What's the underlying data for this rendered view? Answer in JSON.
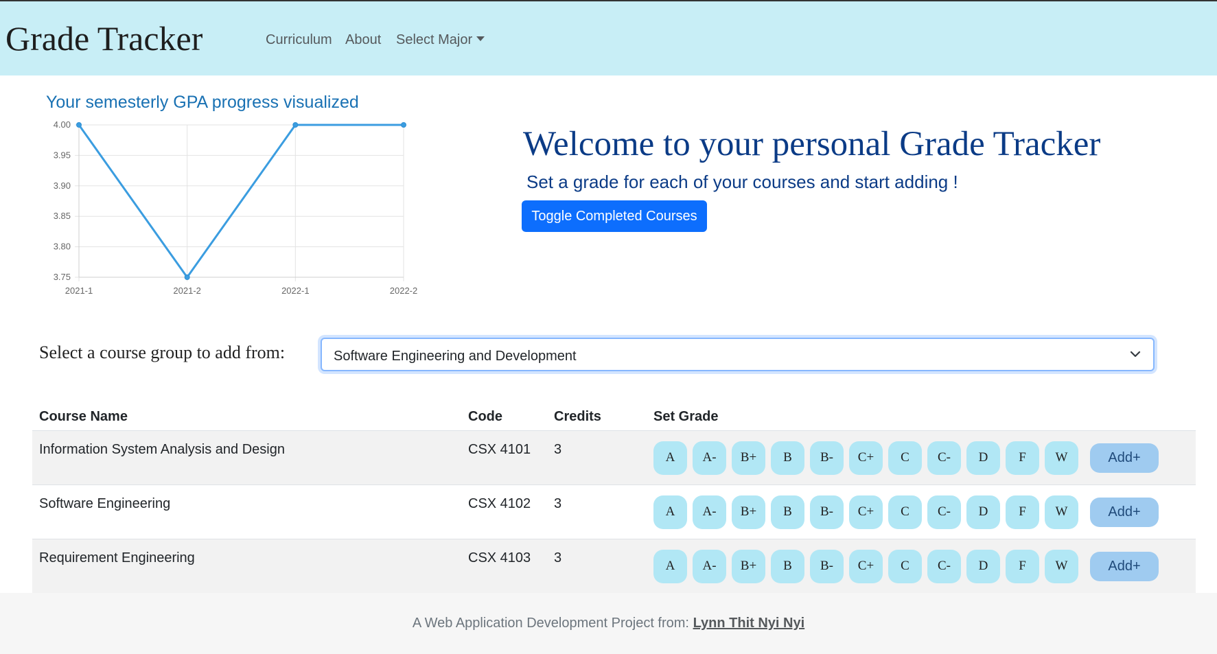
{
  "navbar": {
    "brand": "Grade Tracker",
    "links": [
      "Curriculum",
      "About",
      "Select Major"
    ]
  },
  "chart": {
    "title": "Your semesterly GPA progress visualized"
  },
  "chart_data": {
    "type": "line",
    "categories": [
      "2021-1",
      "2021-2",
      "2022-1",
      "2022-2"
    ],
    "values": [
      4.0,
      3.75,
      4.0,
      4.0
    ],
    "ylim": [
      3.75,
      4.0
    ],
    "yticks": [
      "4.00",
      "3.95",
      "3.90",
      "3.85",
      "3.80",
      "3.75"
    ],
    "line_color": "#3b9de0",
    "grid": true,
    "title": "",
    "xlabel": "",
    "ylabel": ""
  },
  "hero": {
    "heading": "Welcome to your personal Grade Tracker",
    "subtitle": "Set a grade for each of your courses and start adding !",
    "toggle_label": "Toggle Completed Courses"
  },
  "course_group": {
    "label": "Select a course group to add from:",
    "selected": "Software Engineering and Development"
  },
  "table": {
    "headers": [
      "Course Name",
      "Code",
      "Credits",
      "Set Grade"
    ],
    "rows": [
      {
        "name": "Information System Analysis and Design",
        "code": "CSX 4101",
        "credits": "3"
      },
      {
        "name": "Software Engineering",
        "code": "CSX 4102",
        "credits": "3"
      },
      {
        "name": "Requirement Engineering",
        "code": "CSX 4103",
        "credits": "3"
      }
    ],
    "grades": [
      "A",
      "A-",
      "B+",
      "B",
      "B-",
      "C+",
      "C",
      "C-",
      "D",
      "F",
      "W"
    ],
    "add_label": "Add+"
  },
  "footer": {
    "text": "A Web Application Development Project from: ",
    "author": "Lynn Thit Nyi Nyi"
  },
  "colors": {
    "navbar_bg": "#c8eef6",
    "primary_button": "#0d6efd",
    "grade_button": "#b1e7f5",
    "add_button": "#9fcbf0",
    "heading_text": "#0b3b86"
  }
}
